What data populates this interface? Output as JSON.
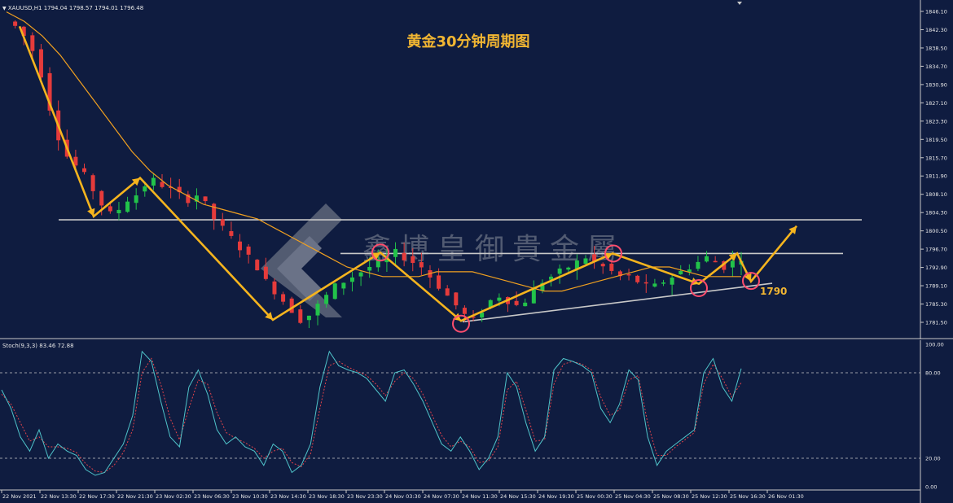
{
  "header": {
    "symbol_line": "XAUUSD,H1  1794.04 1798.57 1794.01 1796.48",
    "stoch_line": "Stoch(9,3,3) 83.46 72.88"
  },
  "chart_title": "黄金30分钟周期图",
  "watermark_text": "鑫博皇御貴金屬",
  "annotation_label": "1790",
  "colors": {
    "background": "#0f1c40",
    "up_candle": "#22c24a",
    "down_candle": "#e53b3b",
    "moving_average": "#f0a020",
    "trend_arrows": "#f5b41e",
    "circles": "#ff4d6d",
    "support_lines": "#c8c8c8",
    "stoch_main": "#4fc3c9",
    "stoch_signal": "#e0434a"
  },
  "chart_data": [
    {
      "type": "candlestick",
      "title": "黄金30分钟周期图",
      "y_ticks": [
        "1846.10",
        "1842.30",
        "1838.50",
        "1834.70",
        "1830.90",
        "1827.10",
        "1823.30",
        "1819.50",
        "1815.70",
        "1811.90",
        "1808.10",
        "1804.30",
        "1800.50",
        "1796.70",
        "1792.90",
        "1789.10",
        "1785.30",
        "1781.50"
      ],
      "ylim": [
        1779.5,
        1848.0
      ],
      "x_ticks": [
        "22 Nov 2021",
        "22 Nov 13:30",
        "22 Nov 17:30",
        "22 Nov 21:30",
        "23 Nov 02:30",
        "23 Nov 06:30",
        "23 Nov 10:30",
        "23 Nov 14:30",
        "23 Nov 18:30",
        "23 Nov 23:30",
        "24 Nov 03:30",
        "24 Nov 07:30",
        "24 Nov 11:30",
        "24 Nov 15:30",
        "24 Nov 19:30",
        "25 Nov 00:30",
        "25 Nov 04:30",
        "25 Nov 08:30",
        "25 Nov 12:30",
        "25 Nov 16:30",
        "26 Nov 01:30"
      ],
      "price_path": [
        1844,
        1843,
        1841,
        1838,
        1833,
        1826,
        1820,
        1816,
        1814,
        1812,
        1809,
        1806,
        1804,
        1805,
        1807,
        1808,
        1810,
        1811,
        1810,
        1809,
        1808,
        1807,
        1808,
        1806,
        1803,
        1801,
        1799,
        1797,
        1795,
        1793,
        1790,
        1788,
        1786,
        1784,
        1782,
        1783,
        1785,
        1787,
        1789,
        1790,
        1791,
        1792,
        1793,
        1794,
        1795,
        1796,
        1795,
        1794,
        1793,
        1791,
        1789,
        1787,
        1785,
        1783,
        1782,
        1784,
        1786,
        1787,
        1786,
        1785,
        1786,
        1788,
        1790,
        1791,
        1792,
        1793,
        1794,
        1795,
        1794,
        1793,
        1792,
        1791,
        1791,
        1790,
        1789,
        1789,
        1790,
        1791,
        1792,
        1793,
        1794,
        1795,
        1794,
        1793,
        1794,
        1795
      ],
      "moving_average_path": [
        1846,
        1844,
        1841,
        1837,
        1832,
        1827,
        1822,
        1817,
        1813,
        1810,
        1808,
        1806,
        1805,
        1804,
        1803,
        1801,
        1799,
        1797,
        1795,
        1793,
        1792,
        1791,
        1791,
        1791,
        1792,
        1792,
        1792,
        1791,
        1790,
        1789,
        1788,
        1788,
        1789,
        1790,
        1791,
        1792,
        1793,
        1793,
        1792,
        1791,
        1791,
        1791
      ],
      "horizontal_levels": [
        1802.8,
        1795.8
      ],
      "annotated_levels": [
        1790
      ]
    },
    {
      "type": "line",
      "title": "Stoch(9,3,3) 83.46 72.88",
      "y_ticks": [
        "100.00",
        "80.00",
        "20.00",
        "0.00"
      ],
      "ylim": [
        0,
        100
      ],
      "levels": [
        20,
        80
      ],
      "series": [
        {
          "name": "Stoch",
          "values": [
            68,
            55,
            35,
            25,
            40,
            20,
            30,
            25,
            22,
            12,
            8,
            10,
            20,
            30,
            50,
            95,
            88,
            60,
            35,
            28,
            70,
            82,
            65,
            40,
            30,
            35,
            28,
            25,
            15,
            30,
            25,
            10,
            15,
            30,
            70,
            95,
            85,
            82,
            80,
            76,
            68,
            60,
            80,
            82,
            72,
            60,
            45,
            30,
            25,
            35,
            25,
            12,
            20,
            35,
            80,
            70,
            45,
            25,
            35,
            82,
            90,
            88,
            85,
            80,
            55,
            45,
            58,
            82,
            75,
            35,
            15,
            25,
            30,
            35,
            40,
            80,
            90,
            70,
            60,
            83
          ]
        },
        {
          "name": "Signal",
          "values": [
            65,
            58,
            45,
            32,
            35,
            28,
            28,
            27,
            24,
            16,
            11,
            10,
            15,
            24,
            40,
            80,
            90,
            72,
            48,
            33,
            55,
            75,
            72,
            52,
            38,
            34,
            31,
            27,
            20,
            25,
            27,
            17,
            14,
            23,
            55,
            85,
            88,
            84,
            81,
            78,
            72,
            64,
            74,
            80,
            76,
            65,
            50,
            36,
            28,
            32,
            28,
            17,
            18,
            28,
            68,
            74,
            54,
            32,
            33,
            72,
            86,
            88,
            86,
            82,
            63,
            50,
            54,
            75,
            78,
            45,
            22,
            22,
            28,
            33,
            38,
            72,
            86,
            76,
            63,
            73
          ]
        }
      ]
    }
  ]
}
